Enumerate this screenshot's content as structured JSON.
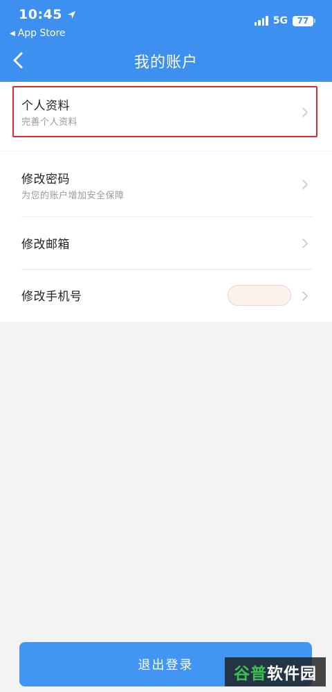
{
  "status_bar": {
    "time": "10:45",
    "back_app": "App Store",
    "network": "5G",
    "battery": "77"
  },
  "nav": {
    "title": "我的账户"
  },
  "profile": {
    "title": "个人资料",
    "subtitle": "完善个人资料"
  },
  "settings": [
    {
      "title": "修改密码",
      "subtitle": "为您的账户增加安全保障"
    },
    {
      "title": "修改邮箱"
    },
    {
      "title": "修改手机号"
    }
  ],
  "logout_label": "退出登录",
  "watermark": {
    "part1": "谷普",
    "part2": "软件园"
  },
  "colors": {
    "header": "#3d8ff0",
    "highlight": "#e02a2a",
    "button": "#4295f2"
  },
  "icons": [
    "location-arrow-icon",
    "signal-icon",
    "battery-icon",
    "back-chevron-icon",
    "chevron-right-icon"
  ]
}
